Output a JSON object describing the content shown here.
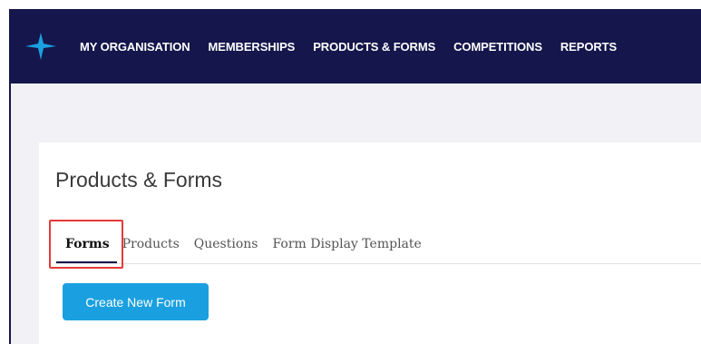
{
  "nav": {
    "items": [
      {
        "label": "MY ORGANISATION",
        "active": false
      },
      {
        "label": "MEMBERSHIPS",
        "active": false
      },
      {
        "label": "PRODUCTS & FORMS",
        "active": true
      },
      {
        "label": "COMPETITIONS",
        "active": false
      },
      {
        "label": "REPORTS",
        "active": false
      }
    ]
  },
  "page": {
    "title": "Products & Forms"
  },
  "tabs": [
    {
      "label": "Forms",
      "active": true
    },
    {
      "label": "Products",
      "active": false
    },
    {
      "label": "Questions",
      "active": false
    },
    {
      "label": "Form Display Template",
      "active": false
    }
  ],
  "actions": {
    "create_form_label": "Create New Form"
  },
  "colors": {
    "navbar_bg": "#15164b",
    "accent_button": "#1aa0e0",
    "highlight": "#e53a3a",
    "logo": "#1aa0e0"
  },
  "icons": {
    "logo": "star-logo-icon"
  }
}
